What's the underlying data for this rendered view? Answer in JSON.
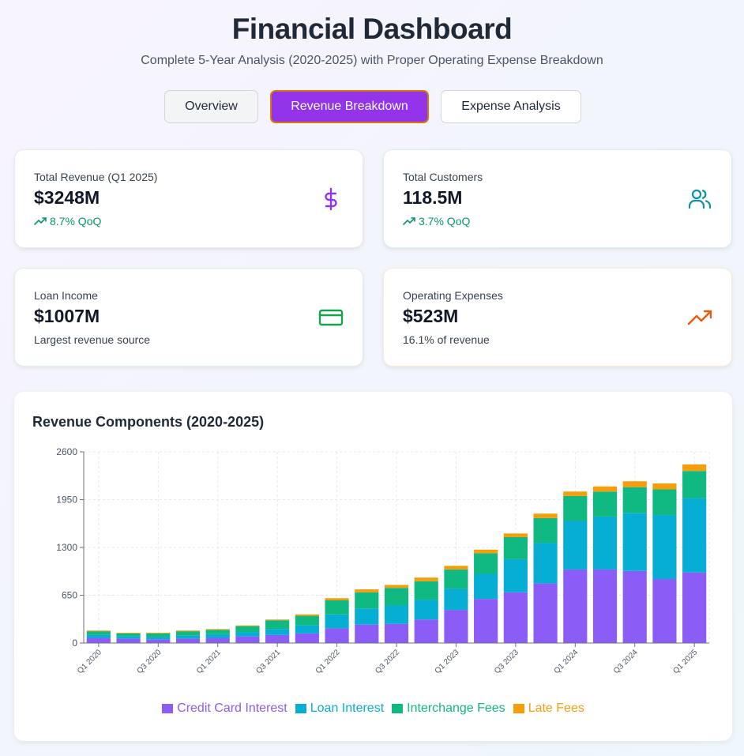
{
  "header": {
    "title": "Financial Dashboard",
    "subtitle": "Complete 5-Year Analysis (2020-2025) with Proper Operating Expense Breakdown"
  },
  "tabs": [
    {
      "label": "Overview",
      "active": false
    },
    {
      "label": "Revenue Breakdown",
      "active": true
    },
    {
      "label": "Expense Analysis",
      "active": false
    }
  ],
  "cards": {
    "total_revenue": {
      "label": "Total Revenue (Q1 2025)",
      "value": "$3248M",
      "sub": "8.7% QoQ",
      "icon": "dollar-icon",
      "color": "#9333ea"
    },
    "total_customers": {
      "label": "Total Customers",
      "value": "118.5M",
      "sub": "3.7% QoQ",
      "icon": "users-icon",
      "color": "#0e8fa8"
    },
    "loan_income": {
      "label": "Loan Income",
      "value": "$1007M",
      "sub": "Largest revenue source",
      "icon": "credit-card-icon",
      "color": "#16a34a"
    },
    "operating_expenses": {
      "label": "Operating Expenses",
      "value": "$523M",
      "sub": "16.1% of revenue",
      "icon": "trending-up-icon",
      "color": "#ea580c"
    }
  },
  "chart_data": {
    "type": "bar",
    "stacked": true,
    "title": "Revenue Components (2020-2025)",
    "categories": [
      "Q1 2020",
      "Q2 2020",
      "Q3 2020",
      "Q4 2020",
      "Q1 2021",
      "Q2 2021",
      "Q3 2021",
      "Q4 2021",
      "Q1 2022",
      "Q2 2022",
      "Q3 2022",
      "Q4 2022",
      "Q1 2023",
      "Q2 2023",
      "Q3 2023",
      "Q4 2023",
      "Q1 2024",
      "Q2 2024",
      "Q3 2024",
      "Q4 2024",
      "Q1 2025"
    ],
    "xtick_labels": [
      "Q1 2020",
      "Q3 2020",
      "Q1 2021",
      "Q3 2021",
      "Q1 2022",
      "Q3 2022",
      "Q1 2023",
      "Q3 2023",
      "Q1 2024",
      "Q3 2024",
      "Q1 2025"
    ],
    "yticks": [
      0,
      650,
      1300,
      1950,
      2600
    ],
    "ylim": [
      0,
      2600
    ],
    "grid": true,
    "legend_position": "bottom",
    "series": [
      {
        "name": "Credit Card Interest",
        "color": "#8b5cf6",
        "values": [
          70,
          60,
          50,
          60,
          70,
          90,
          110,
          130,
          200,
          250,
          260,
          320,
          450,
          600,
          690,
          810,
          1000,
          1000,
          980,
          870,
          960
        ]
      },
      {
        "name": "Loan Interest",
        "color": "#06aed4",
        "values": [
          40,
          30,
          30,
          40,
          50,
          60,
          80,
          110,
          190,
          220,
          250,
          270,
          290,
          340,
          450,
          550,
          660,
          720,
          790,
          870,
          1010
        ]
      },
      {
        "name": "Interchange Fees",
        "color": "#10b981",
        "values": [
          50,
          40,
          50,
          60,
          60,
          80,
          120,
          130,
          190,
          220,
          240,
          250,
          260,
          280,
          300,
          340,
          340,
          340,
          350,
          350,
          370
        ]
      },
      {
        "name": "Late Fees",
        "color": "#f59e0b",
        "values": [
          10,
          10,
          10,
          10,
          10,
          10,
          10,
          20,
          30,
          40,
          40,
          50,
          50,
          50,
          50,
          60,
          60,
          70,
          80,
          80,
          90
        ]
      }
    ]
  }
}
